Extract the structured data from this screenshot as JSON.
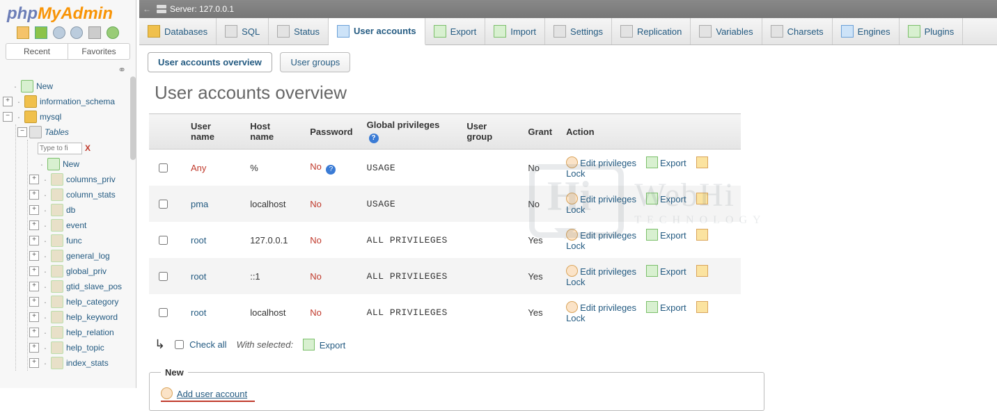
{
  "server": {
    "label": "Server: 127.0.0.1",
    "back": "←"
  },
  "logo": {
    "p1": "php",
    "p2": "MyAdmin"
  },
  "left_tabs": {
    "recent": "Recent",
    "favorites": "Favorites"
  },
  "link_icon": "⚭",
  "tree": {
    "new": "New",
    "information_schema": "information_schema",
    "mysql": "mysql",
    "tables": "Tables",
    "filter_placeholder": "Type to fi",
    "filter_x": "X",
    "tables_new": "New",
    "items": [
      "columns_priv",
      "column_stats",
      "db",
      "event",
      "func",
      "general_log",
      "global_priv",
      "gtid_slave_pos",
      "help_category",
      "help_keyword",
      "help_relation",
      "help_topic",
      "index_stats"
    ]
  },
  "toptabs": [
    {
      "id": "databases",
      "label": "Databases",
      "icon": "ic-db"
    },
    {
      "id": "sql",
      "label": "SQL",
      "icon": "ic-sql"
    },
    {
      "id": "status",
      "label": "Status",
      "icon": "ic-stat"
    },
    {
      "id": "users",
      "label": "User accounts",
      "icon": "ic-user",
      "active": true
    },
    {
      "id": "export",
      "label": "Export",
      "icon": "ic-exp"
    },
    {
      "id": "import",
      "label": "Import",
      "icon": "ic-imp"
    },
    {
      "id": "settings",
      "label": "Settings",
      "icon": "ic-set"
    },
    {
      "id": "replication",
      "label": "Replication",
      "icon": "ic-rep"
    },
    {
      "id": "variables",
      "label": "Variables",
      "icon": "ic-var"
    },
    {
      "id": "charsets",
      "label": "Charsets",
      "icon": "ic-chs"
    },
    {
      "id": "engines",
      "label": "Engines",
      "icon": "ic-eng"
    },
    {
      "id": "plugins",
      "label": "Plugins",
      "icon": "ic-plg"
    }
  ],
  "subtabs": {
    "overview": "User accounts overview",
    "groups": "User groups"
  },
  "page_title": "User accounts overview",
  "columns": {
    "user": "User name",
    "host": "Host name",
    "pass": "Password",
    "priv": "Global privileges",
    "group": "User group",
    "grant": "Grant",
    "action": "Action"
  },
  "actions": {
    "edit": "Edit privileges",
    "export": "Export",
    "lock": "Lock"
  },
  "rows": [
    {
      "user": "Any",
      "user_red": true,
      "host": "%",
      "pass": "No",
      "pass_help": true,
      "priv": "USAGE",
      "group": "",
      "grant": "No"
    },
    {
      "user": "pma",
      "host": "localhost",
      "pass": "No",
      "priv": "USAGE",
      "group": "",
      "grant": "No"
    },
    {
      "user": "root",
      "host": "127.0.0.1",
      "pass": "No",
      "priv": "ALL PRIVILEGES",
      "group": "",
      "grant": "Yes"
    },
    {
      "user": "root",
      "host": "::1",
      "pass": "No",
      "priv": "ALL PRIVILEGES",
      "group": "",
      "grant": "Yes"
    },
    {
      "user": "root",
      "host": "localhost",
      "pass": "No",
      "priv": "ALL PRIVILEGES",
      "group": "",
      "grant": "Yes"
    }
  ],
  "checkall": {
    "label": "Check all",
    "with_selected": "With selected:",
    "export": "Export"
  },
  "newbox": {
    "legend": "New",
    "add": "Add user account"
  },
  "watermark": {
    "hi": "Hi",
    "brand": "WebHi",
    "sub": "TECHNOLOGY"
  }
}
